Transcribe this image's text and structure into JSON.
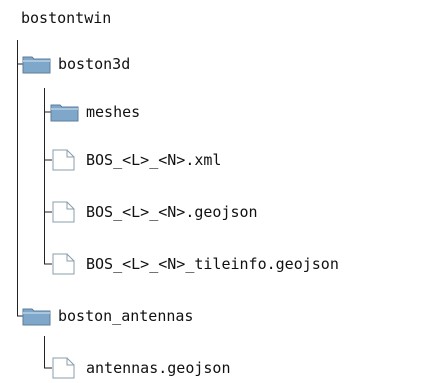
{
  "tree": {
    "root": {
      "label": "bostontwin"
    },
    "items": [
      {
        "label": "boston3d",
        "type": "folder",
        "icon": "folder-icon"
      },
      {
        "label": "meshes",
        "type": "folder",
        "icon": "folder-icon"
      },
      {
        "label": "BOS_<L>_<N>.xml",
        "type": "file",
        "icon": "file-icon"
      },
      {
        "label": "BOS_<L>_<N>.geojson",
        "type": "file",
        "icon": "file-icon"
      },
      {
        "label": "BOS_<L>_<N>_tileinfo.geojson",
        "type": "file",
        "icon": "file-icon"
      },
      {
        "label": "boston_antennas",
        "type": "folder",
        "icon": "folder-icon"
      },
      {
        "label": "antennas.geojson",
        "type": "file",
        "icon": "file-icon"
      }
    ]
  },
  "colors": {
    "folder_fill": "#7fa7c9",
    "folder_top": "#a9c6df",
    "folder_stroke": "#5c7e9a",
    "file_stroke": "#8a9cab",
    "line": "#222222"
  }
}
